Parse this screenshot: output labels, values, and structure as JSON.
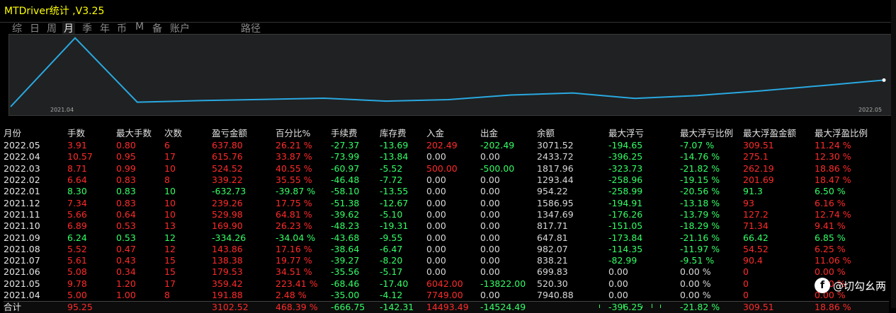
{
  "window": {
    "title": "MTDriver统计 ,V3.25"
  },
  "tabs": [
    {
      "label": "综",
      "active": false
    },
    {
      "label": "日",
      "active": false
    },
    {
      "label": "周",
      "active": false
    },
    {
      "label": "月",
      "active": true
    },
    {
      "label": "季",
      "active": false
    },
    {
      "label": "年",
      "active": false
    },
    {
      "label": "币",
      "active": false
    },
    {
      "label": "M",
      "active": false
    },
    {
      "label": "备",
      "active": false
    },
    {
      "label": "账户",
      "active": false
    },
    {
      "label": "路径",
      "active": false
    }
  ],
  "chart_data": {
    "type": "line",
    "x": [
      "2021.04",
      "2021.05",
      "2021.06",
      "2021.07",
      "2021.08",
      "2021.09",
      "2021.10",
      "2021.11",
      "2021.12",
      "2022.01",
      "2022.02",
      "2022.03",
      "2022.04",
      "2022.05"
    ],
    "series": [
      {
        "values": [
          7940.88,
          520.3,
          699.83,
          838.21,
          982.07,
          647.81,
          817.71,
          1347.69,
          1586.95,
          954.22,
          1293.44,
          1817.96,
          2433.72,
          3071.52
        ]
      }
    ],
    "x_tick_labels": [
      "2021.04",
      "2022.05"
    ],
    "line_color": "#29a9e1",
    "background": "#202122"
  },
  "table": {
    "headers": [
      "月份",
      "手数",
      "最大手数",
      "次数",
      "盈亏金额",
      "百分比%",
      "手续费",
      "库存费",
      "入金",
      "出金",
      "余额",
      "最大浮亏",
      "最大浮亏比例",
      "最大浮盈金额",
      "最大浮盈比例"
    ],
    "rows": [
      [
        "2022.05",
        "3.91",
        "0.80",
        "6",
        "637.80",
        "26.21 %",
        "-27.37",
        "-13.69",
        "202.49",
        "-202.49",
        "3071.52",
        "-194.65",
        "-7.07 %",
        "309.51",
        "11.24 %"
      ],
      [
        "2022.04",
        "10.57",
        "0.95",
        "17",
        "615.76",
        "33.87 %",
        "-73.99",
        "-13.84",
        "0.00",
        "0.00",
        "2433.72",
        "-396.25",
        "-14.76 %",
        "275.1",
        "12.30 %"
      ],
      [
        "2022.03",
        "8.71",
        "0.99",
        "10",
        "524.52",
        "40.55 %",
        "-60.97",
        "-5.52",
        "500.00",
        "-500.00",
        "1817.96",
        "-323.73",
        "-21.82 %",
        "262.19",
        "18.86 %"
      ],
      [
        "2022.02",
        "6.64",
        "0.83",
        "8",
        "339.22",
        "35.55 %",
        "-46.48",
        "-7.72",
        "0.00",
        "0.00",
        "1293.44",
        "-258.96",
        "-19.15 %",
        "201.69",
        "18.47 %"
      ],
      [
        "2022.01",
        "8.30",
        "0.83",
        "10",
        "-632.73",
        "-39.87 %",
        "-58.10",
        "-13.55",
        "0.00",
        "0.00",
        "954.22",
        "-258.99",
        "-20.56 %",
        "91.3",
        "6.50 %"
      ],
      [
        "2021.12",
        "7.34",
        "0.83",
        "10",
        "239.26",
        "17.75 %",
        "-51.38",
        "-12.67",
        "0.00",
        "0.00",
        "1586.95",
        "-194.91",
        "-13.18 %",
        "93",
        "6.16 %"
      ],
      [
        "2021.11",
        "5.66",
        "0.64",
        "10",
        "529.98",
        "64.81 %",
        "-39.62",
        "-5.10",
        "0.00",
        "0.00",
        "1347.69",
        "-176.26",
        "-13.79 %",
        "127.2",
        "12.74 %"
      ],
      [
        "2021.10",
        "6.89",
        "0.53",
        "13",
        "169.90",
        "26.23 %",
        "-48.23",
        "-19.31",
        "0.00",
        "0.00",
        "817.71",
        "-151.05",
        "-18.29 %",
        "71.34",
        "9.41 %"
      ],
      [
        "2021.09",
        "6.24",
        "0.53",
        "12",
        "-334.26",
        "-34.04 %",
        "-43.68",
        "-9.55",
        "0.00",
        "0.00",
        "647.81",
        "-173.84",
        "-21.16 %",
        "66.42",
        "6.85 %"
      ],
      [
        "2021.08",
        "5.52",
        "0.47",
        "12",
        "143.86",
        "17.16 %",
        "-38.64",
        "-6.47",
        "0.00",
        "0.00",
        "982.07",
        "-114.35",
        "-11.97 %",
        "54.52",
        "6.25 %"
      ],
      [
        "2021.07",
        "5.61",
        "0.43",
        "15",
        "138.38",
        "19.77 %",
        "-39.27",
        "-8.20",
        "0.00",
        "0.00",
        "838.21",
        "-82.99",
        "-9.51 %",
        "90.4",
        "11.06 %"
      ],
      [
        "2021.06",
        "5.08",
        "0.34",
        "15",
        "179.53",
        "34.51 %",
        "-35.56",
        "-5.17",
        "0.00",
        "0.00",
        "699.83",
        "0.00",
        "0.00 %",
        "0",
        "0.00 %"
      ],
      [
        "2021.05",
        "9.78",
        "1.20",
        "17",
        "359.42",
        "223.41 %",
        "-68.46",
        "-17.40",
        "6042.00",
        "-13822.00",
        "520.30",
        "0.00",
        "0.00 %",
        "0",
        "0.00 %"
      ],
      [
        "2021.04",
        "5.00",
        "1.00",
        "8",
        "191.88",
        "2.48 %",
        "-35.00",
        "-4.12",
        "7749.00",
        "0.00",
        "7940.88",
        "0.00",
        "0.00 %",
        "0",
        "0.00 %"
      ]
    ],
    "total": [
      "合计",
      "95.25",
      "",
      "",
      "3102.52",
      "468.39 %",
      "-666.75",
      "-142.31",
      "14493.49",
      "-14524.49",
      "",
      "-396.25",
      "-21.82 %",
      "309.51",
      "18.86 %"
    ]
  },
  "watermark": {
    "icon": "f",
    "text": "@切勾幺两"
  },
  "colors": {
    "positive": "#ff2a2a",
    "negative": "#33ff66",
    "title": "#ffff00"
  }
}
